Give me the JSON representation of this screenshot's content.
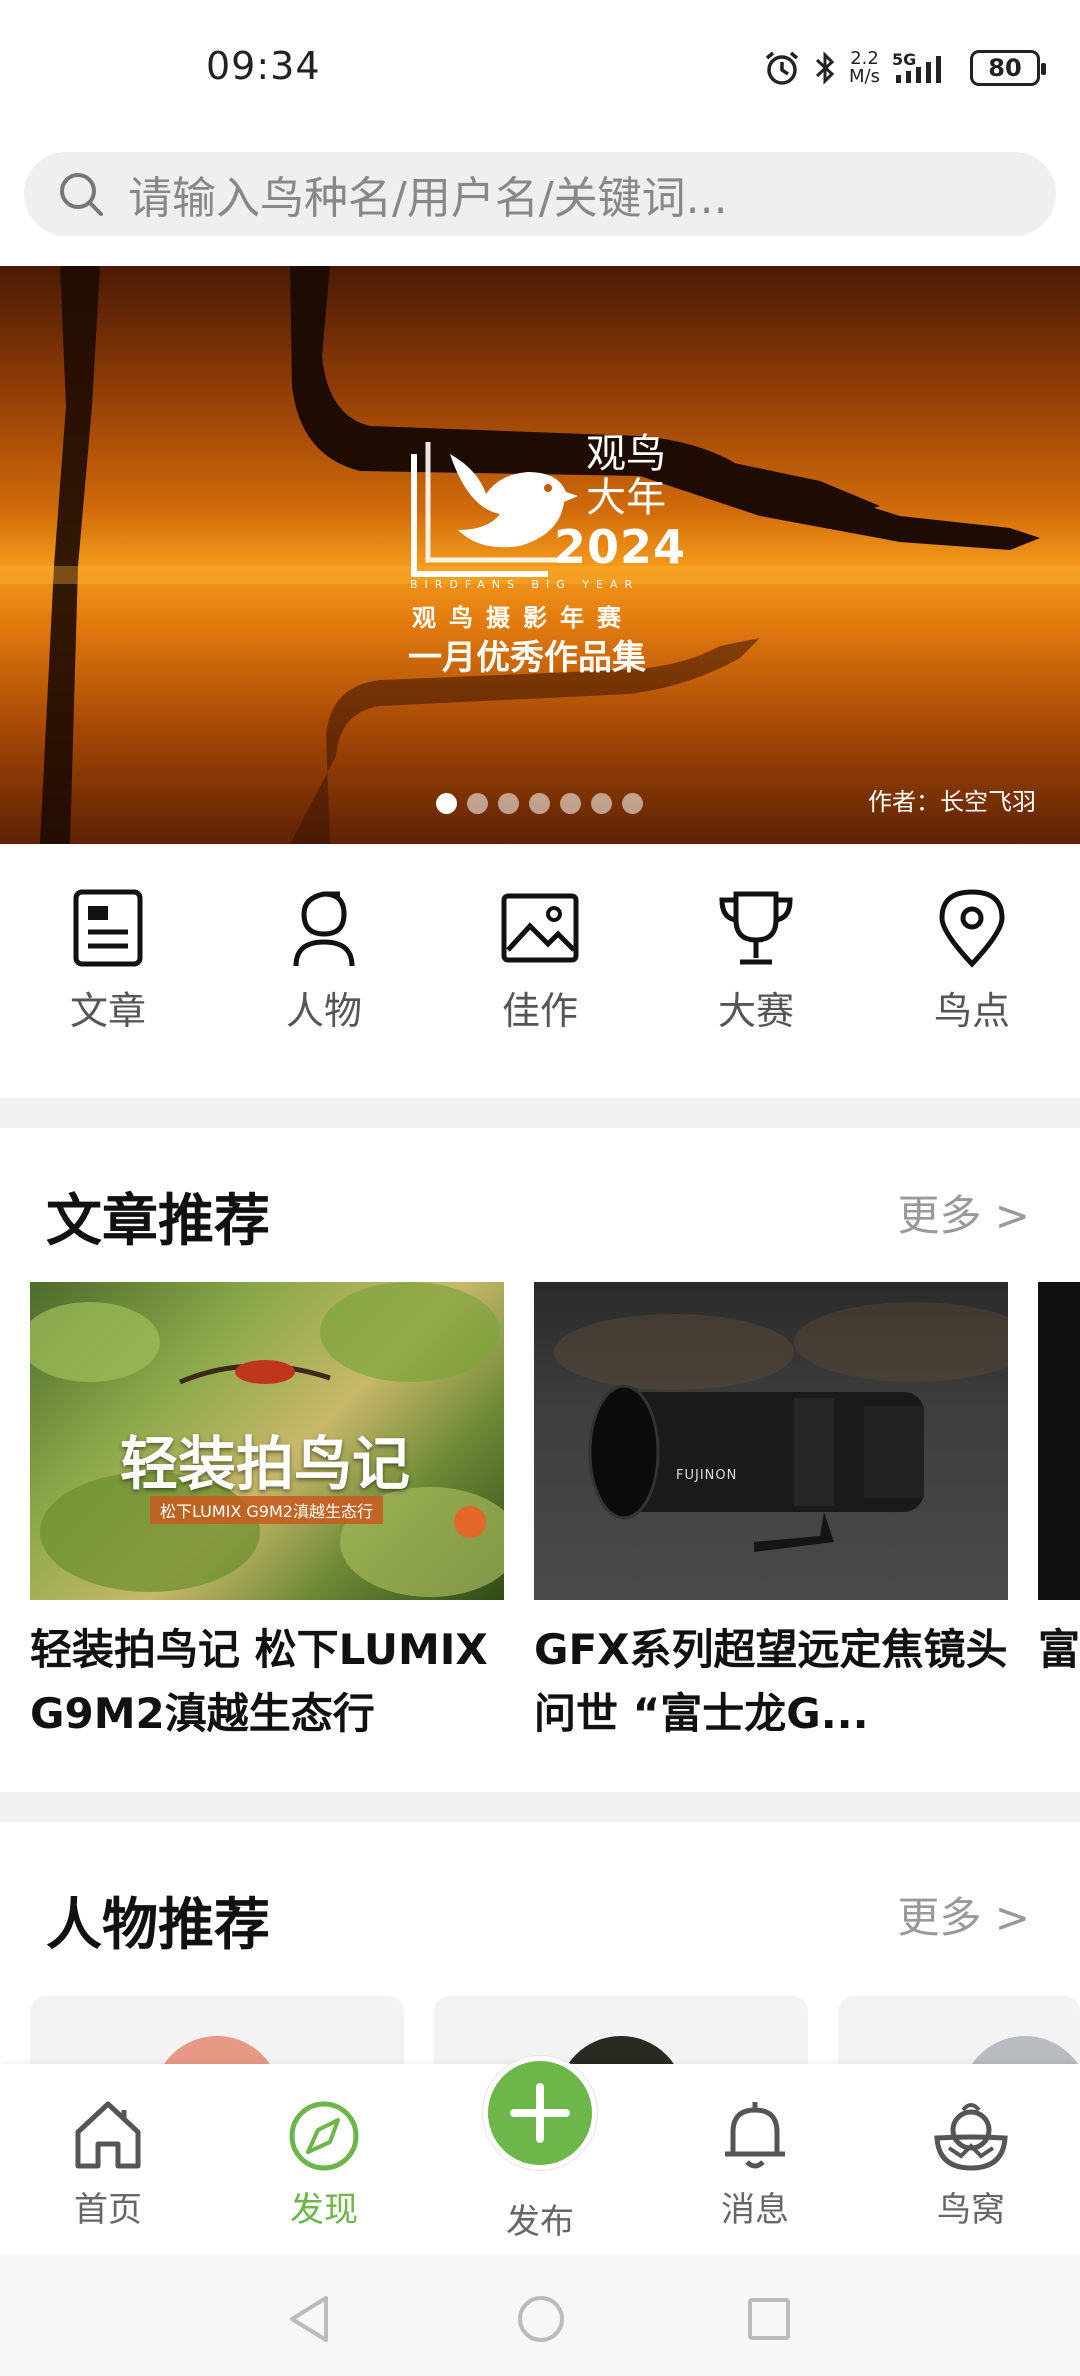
{
  "status_bar": {
    "time": "09:34",
    "net_speed_value": "2.2",
    "net_speed_unit": "M/s",
    "network": "5G",
    "battery": "80"
  },
  "search": {
    "placeholder": "请输入鸟种名/用户名/关键词..."
  },
  "banner": {
    "logo_title_line1": "观鸟",
    "logo_title_line2": "大年",
    "logo_year": "2024",
    "logo_en": "BIRDFANS BIG YEAR",
    "logo_sub1": "观鸟摄影年赛",
    "logo_sub2": "一月优秀作品集",
    "author": "作者：长空飞羽",
    "dot_count": 7,
    "active_dot": 1
  },
  "categories": [
    {
      "label": "文章",
      "icon": "article-icon"
    },
    {
      "label": "人物",
      "icon": "person-icon"
    },
    {
      "label": "佳作",
      "icon": "image-icon"
    },
    {
      "label": "大赛",
      "icon": "trophy-icon"
    },
    {
      "label": "鸟点",
      "icon": "location-pin-icon"
    }
  ],
  "articles_section": {
    "title": "文章推荐",
    "more": "更多 >",
    "items": [
      {
        "title": "轻装拍鸟记 松下LUMIX G9M2滇越生态行",
        "thumb_text": "轻装拍鸟记",
        "thumb_subtext": "松下LUMIX G9M2滇越生态行"
      },
      {
        "title": "GFX系列超望远定焦镜头问世 “富士龙G...",
        "thumb_text": "FUJINON"
      },
      {
        "title": "富士...反..."
      }
    ]
  },
  "people_section": {
    "title": "人物推荐",
    "more": "更多 >"
  },
  "bottom_nav": {
    "items": [
      {
        "label": "首页",
        "icon": "home-icon"
      },
      {
        "label": "发现",
        "icon": "compass-icon",
        "active": true
      },
      {
        "label": "发布",
        "icon": "plus-icon"
      },
      {
        "label": "消息",
        "icon": "bell-icon"
      },
      {
        "label": "鸟窝",
        "icon": "bird-nest-icon"
      }
    ]
  },
  "colors": {
    "accent": "#6db64a",
    "banner_orange": "#f39a1b",
    "band_gray": "#f1f1f1"
  }
}
